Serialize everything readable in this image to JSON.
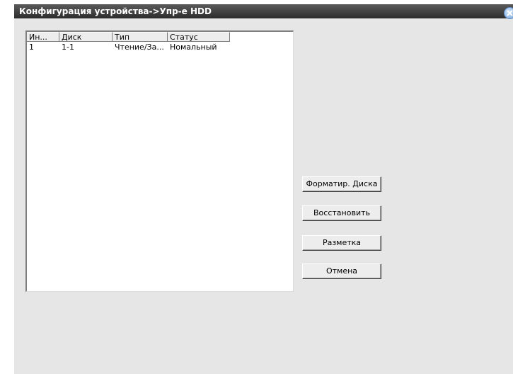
{
  "window": {
    "title": "Конфигурация устройства->Упр-е HDD"
  },
  "table": {
    "columns": [
      "Ин...",
      "Диск",
      "Тип",
      "Статус"
    ],
    "rows": [
      [
        "1",
        "1-1",
        "Чтение/За...",
        "Номальный"
      ]
    ]
  },
  "buttons": {
    "format": "Форматир. Диска",
    "restore": "Восстановить",
    "partition": "Разметка",
    "cancel": "Отмена"
  },
  "colors": {
    "titlebar": "#3a3a3a",
    "dialog_bg": "#e6e6e6",
    "close_button": "#7aa7da"
  },
  "icons": {
    "close": "close-icon"
  }
}
